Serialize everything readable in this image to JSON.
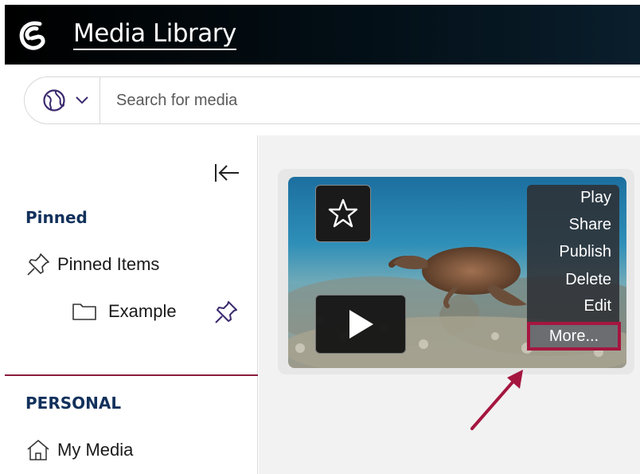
{
  "header": {
    "title": "Media Library"
  },
  "search": {
    "placeholder": "Search for media"
  },
  "sidebar": {
    "pinned_heading": "Pinned",
    "pinned_items_label": "Pinned Items",
    "folder_label": "Example",
    "personal_heading": "PERSONAL",
    "my_media_label": "My Media"
  },
  "media_card": {
    "menu": {
      "items": [
        "Play",
        "Share",
        "Publish",
        "Delete",
        "Edit"
      ],
      "more_label": "More..."
    }
  },
  "colors": {
    "header_bg": "#000000",
    "heading_text": "#12315c",
    "accent": "#a5163f",
    "divider": "#8a1c3c"
  },
  "icons": [
    "logo-icon",
    "globe-icon",
    "chevron-down-icon",
    "collapse-left-icon",
    "pin-icon",
    "folder-icon",
    "star-icon",
    "play-icon",
    "home-icon",
    "annotation-arrow"
  ]
}
